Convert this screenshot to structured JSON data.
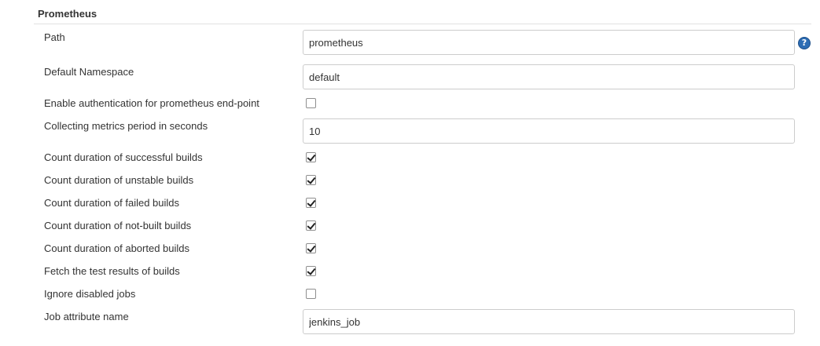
{
  "section": {
    "title": "Prometheus"
  },
  "fields": {
    "path": {
      "label": "Path",
      "value": "prometheus"
    },
    "default_namespace": {
      "label": "Default Namespace",
      "value": "default"
    },
    "enable_auth": {
      "label": "Enable authentication for prometheus end-point",
      "checked": false
    },
    "collecting_period": {
      "label": "Collecting metrics period in seconds",
      "value": "10"
    },
    "count_successful": {
      "label": "Count duration of successful builds",
      "checked": true
    },
    "count_unstable": {
      "label": "Count duration of unstable builds",
      "checked": true
    },
    "count_failed": {
      "label": "Count duration of failed builds",
      "checked": true
    },
    "count_not_built": {
      "label": "Count duration of not-built builds",
      "checked": true
    },
    "count_aborted": {
      "label": "Count duration of aborted builds",
      "checked": true
    },
    "fetch_test_results": {
      "label": "Fetch the test results of builds",
      "checked": true
    },
    "ignore_disabled": {
      "label": "Ignore disabled jobs",
      "checked": false
    },
    "job_attribute_name": {
      "label": "Job attribute name",
      "value": "jenkins_job"
    }
  },
  "help": {
    "glyph": "?",
    "icon": "help-icon"
  }
}
